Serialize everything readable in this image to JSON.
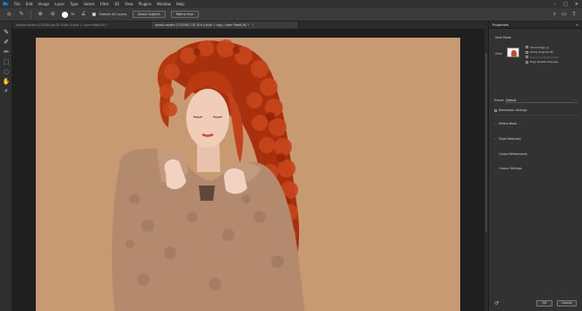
{
  "menubar": {
    "logo": "Ps",
    "items": [
      "File",
      "Edit",
      "Image",
      "Layer",
      "Type",
      "Select",
      "Filter",
      "3D",
      "View",
      "Plugins",
      "Window",
      "Help"
    ]
  },
  "options": {
    "brush_size": "30",
    "sample_all_layers": "Sample All Layers",
    "select_subject": "Select Subject",
    "refine_hair": "Refine Hair"
  },
  "tabs": [
    {
      "label": "pexels-natalie-1132584.jpg @ 16.6% (Layer 1, Layer Mask/16) *",
      "active": false
    },
    {
      "label": "pexels-natalie-1132584-2 @ 25% (Layer 1 copy, Layer Mask/16) *",
      "active": true
    }
  ],
  "panel": {
    "title": "Properties",
    "view_mode": "View Mode",
    "view_label": "View:",
    "view_options": [
      {
        "label": "Show Edge (J)",
        "dim": false
      },
      {
        "label": "Show Original (P)",
        "dim": false
      },
      {
        "label": "Real-time Refinement",
        "dim": true
      },
      {
        "label": "High Quality Preview",
        "dim": false
      }
    ],
    "preset_label": "Preset:",
    "preset_value": "Default",
    "remember": "Remember Settings",
    "sections": [
      "Refine Mode",
      "Edge Detection",
      "Global Refinements",
      "Output Settings"
    ],
    "ok": "OK",
    "cancel": "Cancel"
  },
  "colors": {
    "background_fill": "#c89a72",
    "hair": "#b8360f",
    "coat": "#b58a6e"
  }
}
